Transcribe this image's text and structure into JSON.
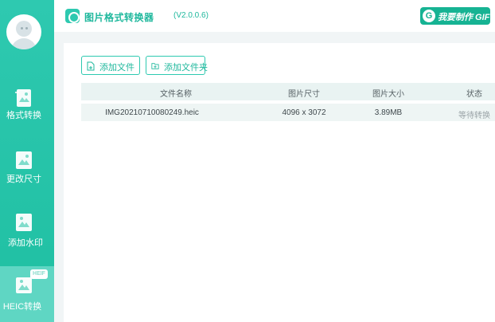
{
  "app": {
    "title": "图片格式转换器",
    "version": "(V2.0.0.6)",
    "gif_button_label": "我要制作 GIF",
    "gif_button_icon_letter": "G"
  },
  "sidebar": {
    "items": [
      {
        "label": "格式转换",
        "icon": "image-convert-icon"
      },
      {
        "label": "更改尺寸",
        "icon": "image-resize-icon"
      },
      {
        "label": "添加水印",
        "icon": "image-watermark-icon"
      },
      {
        "label": "HEIC转换",
        "icon": "image-heic-icon",
        "badge": "HEIF",
        "active": true
      }
    ]
  },
  "toolbar": {
    "add_file_label": "添加文件",
    "add_folder_label": "添加文件夹"
  },
  "table": {
    "columns": [
      "文件名称",
      "图片尺寸",
      "图片大小",
      "状态"
    ],
    "rows": [
      {
        "name": "IMG20210710080249.heic",
        "dimensions": "4096 x 3072",
        "size": "3.89MB",
        "status": "等待转换"
      }
    ]
  },
  "colors": {
    "accent": "#2ec9b0",
    "accent_dark": "#16b393",
    "active_nav": "#5fd6c3",
    "content_bg": "#f1f5f6"
  }
}
